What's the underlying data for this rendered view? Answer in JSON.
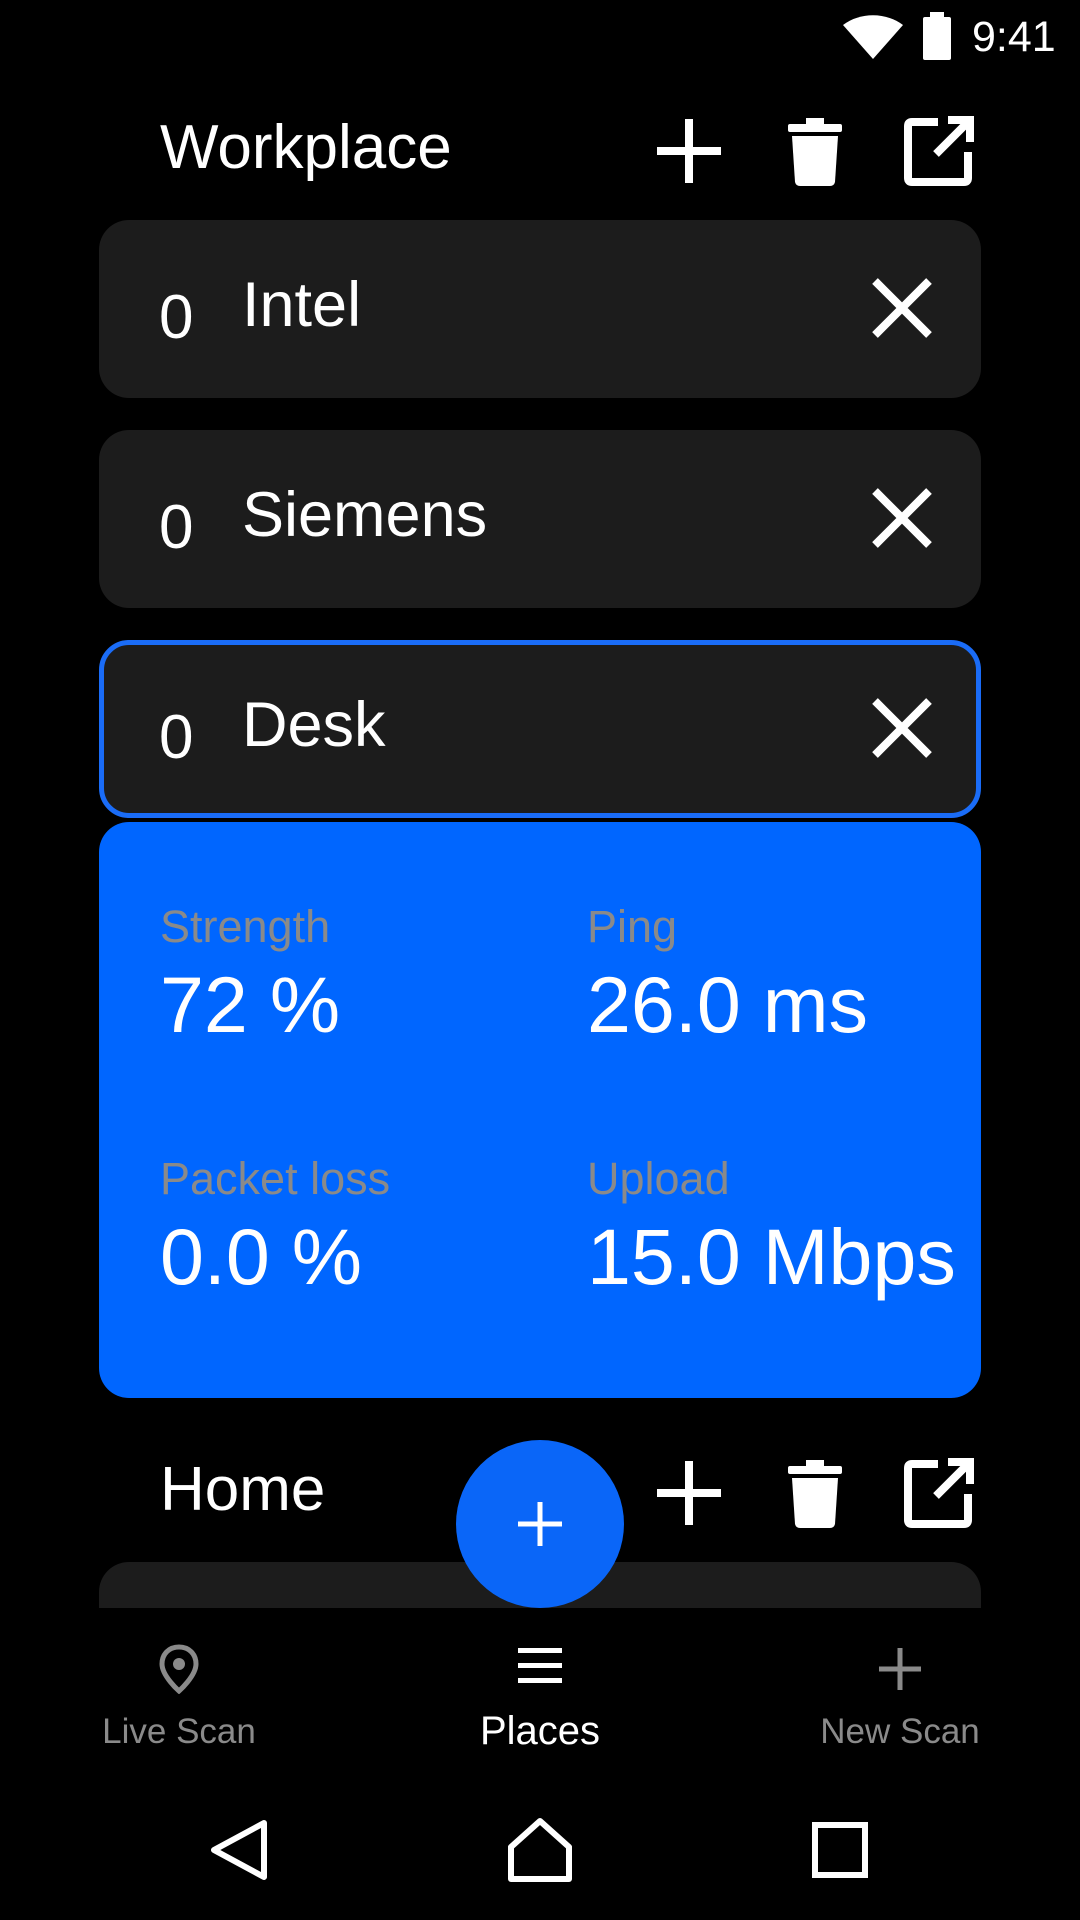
{
  "status_bar": {
    "time": "9:41"
  },
  "sections": [
    {
      "title": "Workplace",
      "places": [
        {
          "count": "0",
          "name": "Intel"
        },
        {
          "count": "0",
          "name": "Siemens"
        },
        {
          "count": "0",
          "name": "Desk",
          "selected": true
        }
      ]
    },
    {
      "title": "Home"
    }
  ],
  "detail": {
    "strength_label": "Strength",
    "strength_value": "72 %",
    "ping_label": "Ping",
    "ping_value": "26.0 ms",
    "packet_loss_label": "Packet loss",
    "packet_loss_value": "0.0 %",
    "upload_label": "Upload",
    "upload_value": "15.0 Mbps"
  },
  "bottom_nav": {
    "items": [
      {
        "label": "Live Scan",
        "icon": "location-pin-icon"
      },
      {
        "label": "Places",
        "icon": "list-icon",
        "active": true
      },
      {
        "label": "New Scan",
        "icon": "plus-icon"
      }
    ]
  },
  "colors": {
    "accent": "#0066ff",
    "card": "#1c1c1c",
    "muted_label": "#8a8a8a",
    "inactive_nav": "#8a8a8a",
    "background": "#000000"
  }
}
